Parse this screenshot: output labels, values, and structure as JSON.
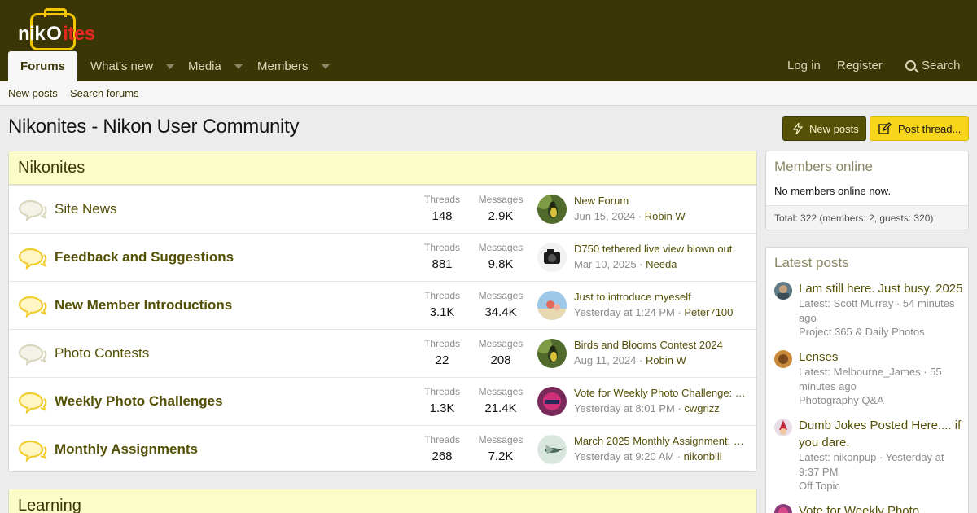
{
  "logo": {
    "text_white_1": "nik",
    "text_white_2": "n",
    "text_red": "ites"
  },
  "nav": {
    "tabs": [
      {
        "label": "Forums",
        "active": true
      },
      {
        "label": "What's new",
        "has_menu": true
      },
      {
        "label": "Media",
        "has_menu": true
      },
      {
        "label": "Members",
        "has_menu": true
      }
    ],
    "login": "Log in",
    "register": "Register",
    "search": "Search",
    "search_icon": "search-icon"
  },
  "subnav": {
    "new_posts": "New posts",
    "search_forums": "Search forums"
  },
  "page": {
    "title": "Nikonites - Nikon User Community",
    "new_posts_btn": "New posts",
    "post_thread_btn": "Post thread..."
  },
  "category": {
    "title": "Nikonites",
    "threads_label": "Threads",
    "messages_label": "Messages",
    "forums": [
      {
        "title": "Site News",
        "unread": false,
        "threads": "148",
        "messages": "2.9K",
        "last_title": "New Forum",
        "last_date": "Jun 15, 2024",
        "last_user": "Robin W",
        "avatar": "bird-green"
      },
      {
        "title": "Feedback and Suggestions",
        "unread": true,
        "threads": "881",
        "messages": "9.8K",
        "last_title": "D750 tethered live view blown out",
        "last_date": "Mar 10, 2025",
        "last_user": "Needa",
        "avatar": "camera-bw"
      },
      {
        "title": "New Member Introductions",
        "unread": true,
        "threads": "3.1K",
        "messages": "34.4K",
        "last_title": "Just to introduce myeself",
        "last_date": "Yesterday at 1:24 PM",
        "last_user": "Peter7100",
        "avatar": "beach"
      },
      {
        "title": "Photo Contests",
        "unread": false,
        "threads": "22",
        "messages": "208",
        "last_title": "Birds and Blooms Contest 2024",
        "last_date": "Aug 11, 2024",
        "last_user": "Robin W",
        "avatar": "bird-green"
      },
      {
        "title": "Weekly Photo Challenges",
        "unread": true,
        "threads": "1.3K",
        "messages": "21.4K",
        "last_title": "Vote for Weekly Photo Challenge: M...",
        "last_date": "Yesterday at 8:01 PM",
        "last_user": "cwgrizz",
        "avatar": "magenta"
      },
      {
        "title": "Monthly Assignments",
        "unread": true,
        "threads": "268",
        "messages": "7.2K",
        "last_title": "March 2025 Monthly Assignment: St...",
        "last_date": "Yesterday at 9:20 AM",
        "last_user": "nikonbill",
        "avatar": "hummingbird"
      }
    ]
  },
  "category2": {
    "title": "Learning"
  },
  "members_online": {
    "title": "Members online",
    "text": "No members online now.",
    "total": "Total: 322 (members: 2, guests: 320)"
  },
  "latest_posts": {
    "title": "Latest posts",
    "items": [
      {
        "title": "I am still here. Just busy. 2025",
        "meta": "Latest: Scott Murray · 54 minutes ago",
        "forum": "Project 365 & Daily Photos"
      },
      {
        "title": "Lenses",
        "meta": "Latest: Melbourne_James · 55 minutes ago",
        "forum": "Photography Q&A"
      },
      {
        "title": "Dumb Jokes Posted Here.... if you dare.",
        "meta": "Latest: nikonpup · Yesterday at 9:37 PM",
        "forum": "Off Topic"
      },
      {
        "title": "Vote for Weekly Photo",
        "meta": "",
        "forum": ""
      }
    ]
  },
  "colors": {
    "header": "#3a3605",
    "accent": "#545006",
    "highlight": "#fcfcc8",
    "button_yellow": "#f7d51a"
  }
}
